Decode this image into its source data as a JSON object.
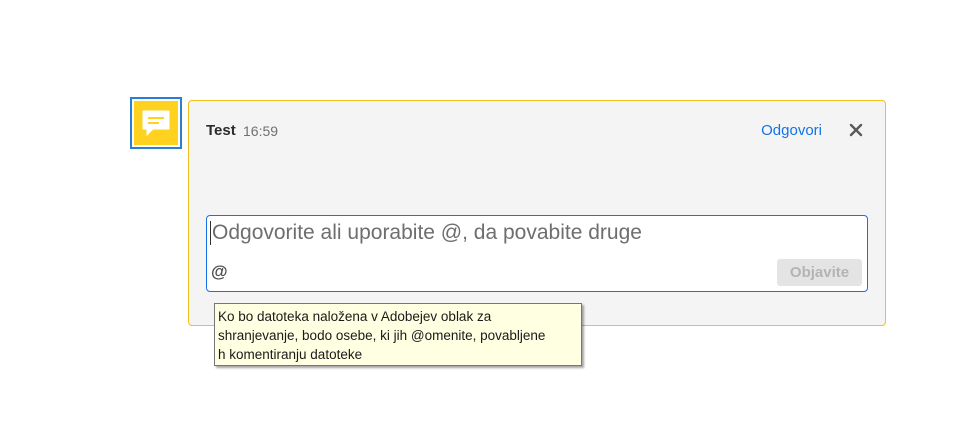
{
  "comment": {
    "author": "Test",
    "time": "16:59",
    "reply_label": "Odgovori",
    "close_icon": "close-icon",
    "note_icon": "comment-note-icon"
  },
  "reply_box": {
    "placeholder": "Odgovorite ali uporabite @, da povabite druge",
    "mention_label": "@",
    "post_label": "Objavite"
  },
  "tooltip": {
    "lines": [
      "Ko bo datoteka naložena v Adobejev oblak za",
      "shranjevanje, bodo osebe, ki jih @omenite, povabljene",
      "h komentiranju datoteke"
    ]
  },
  "colors": {
    "accent_blue": "#1473e6",
    "note_yellow": "#ffd21f",
    "card_border": "#f2c21b",
    "tooltip_bg": "#ffffe1"
  }
}
